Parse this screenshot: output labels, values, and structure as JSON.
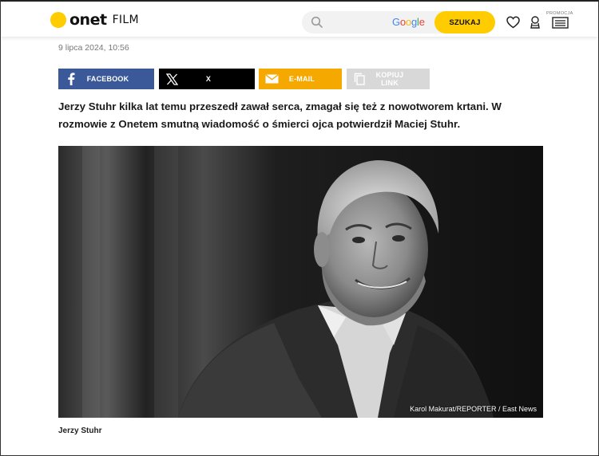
{
  "header": {
    "logo_text": "onet",
    "section": "FILM",
    "search_placeholder": "",
    "google_letters": [
      "G",
      "o",
      "o",
      "g",
      "l",
      "e"
    ],
    "search_button": "SZUKAJ",
    "promo_label": "PROMOCJA",
    "colors": {
      "brand_yellow": "#ffcc00"
    }
  },
  "article": {
    "date": "9 lipca 2024, 10:56",
    "share": {
      "facebook": "FACEBOOK",
      "x": "X",
      "email": "E-MAIL",
      "copy": "KOPIUJ LINK"
    },
    "lead": "Jerzy Stuhr kilka lat temu przeszedł zawał serca, zmagał się też z nowotworem krtani. W rozmowie z Onetem smutną wiadomość o śmierci ojca potwierdził Maciej Stuhr.",
    "photo_credit": "Karol Makurat/REPORTER / East News",
    "caption": "Jerzy Stuhr"
  },
  "icons": {
    "search": "search-icon",
    "favorites": "heart-icon",
    "weather": "weather-icon",
    "promo": "promo-icon",
    "facebook": "facebook-icon",
    "x": "x-logo-icon",
    "email": "envelope-icon",
    "copy": "copy-icon"
  }
}
